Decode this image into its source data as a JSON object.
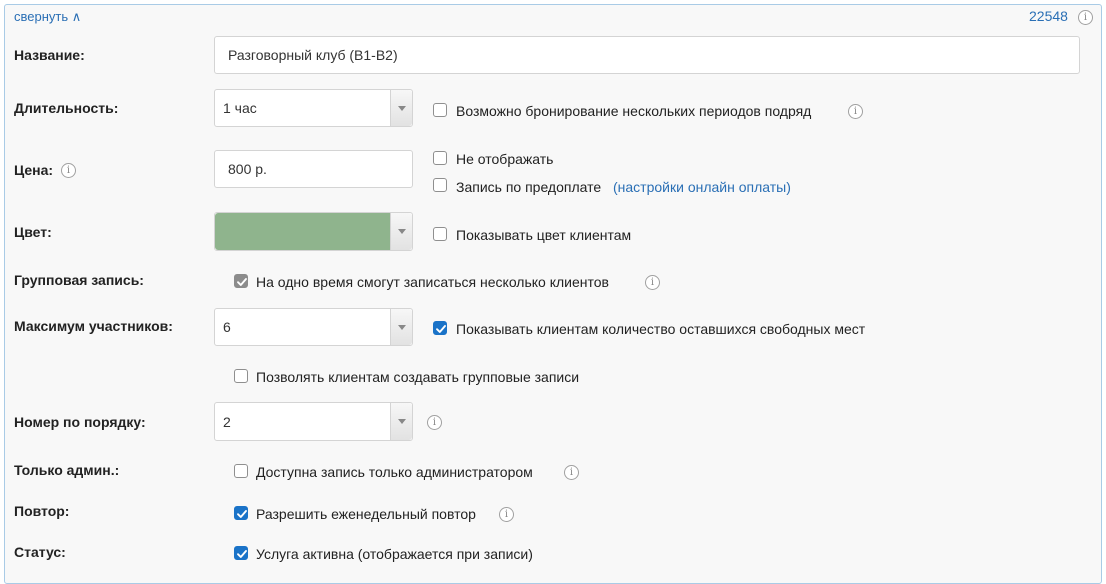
{
  "header": {
    "collapse_label": "свернуть ∧",
    "service_id": "22548"
  },
  "fields": {
    "name": {
      "label": "Название:",
      "value": "Разговорный клуб (B1-B2)"
    },
    "duration": {
      "label": "Длительность:",
      "value": "1 час",
      "multi_period_label": "Возможно бронирование нескольких периодов подряд",
      "multi_period_checked": false
    },
    "price": {
      "label": "Цена:",
      "value": "800 р.",
      "hide_label": "Не отображать",
      "hide_checked": false,
      "prepay_label": "Запись по предоплате",
      "prepay_link": "(настройки онлайн оплаты)",
      "prepay_checked": false
    },
    "color": {
      "label": "Цвет:",
      "swatch": "#8fb48d",
      "show_label": "Показывать цвет клиентам",
      "show_checked": false
    },
    "group": {
      "label": "Групповая запись:",
      "multi_clients_label": "На одно время смогут записаться несколько клиентов",
      "multi_clients_checked": true
    },
    "max_participants": {
      "label": "Максимум участников:",
      "value": "6",
      "show_free_label": "Показывать клиентам количество оставшихся свободных мест",
      "show_free_checked": true,
      "allow_group_label": "Позволять клиентам создавать групповые записи",
      "allow_group_checked": false
    },
    "order": {
      "label": "Номер по порядку:",
      "value": "2"
    },
    "admin_only": {
      "label": "Только админ.:",
      "option_label": "Доступна запись только администратором",
      "checked": false
    },
    "repeat": {
      "label": "Повтор:",
      "option_label": "Разрешить еженедельный повтор",
      "checked": true
    },
    "status": {
      "label": "Статус:",
      "option_label": "Услуга активна (отображается при записи)",
      "checked": true
    }
  },
  "colors": {
    "accent": "#1a73c8",
    "link": "#2a6fb5",
    "border": "#a9cbe6"
  }
}
